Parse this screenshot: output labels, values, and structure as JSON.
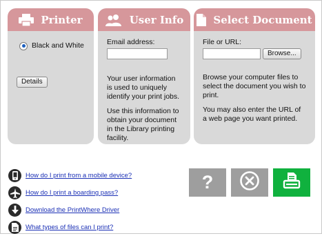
{
  "panels": {
    "printer": {
      "title": "Printer",
      "option_label": "Black and White",
      "details_label": "Details"
    },
    "user_info": {
      "title": "User Info",
      "email_label": "Email address:",
      "desc_1": "Your user information is used to uniquely identify your print jobs.",
      "desc_2": "Use this information to obtain your document in the Library printing facility."
    },
    "select_document": {
      "title": "Select Document",
      "file_label": "File or URL:",
      "browse_label": "Browse...",
      "desc_1": "Browse your computer files to select the document you wish to print.",
      "desc_2": "You may also enter the URL of a web page you want printed."
    }
  },
  "help_links": [
    {
      "icon": "mobile-phone-icon",
      "label": "How do I print from a mobile device?"
    },
    {
      "icon": "airplane-icon",
      "label": "How do I print a boarding pass?"
    },
    {
      "icon": "download-icon",
      "label": "Download the PrintWhere Driver"
    },
    {
      "icon": "document-icon",
      "label": "What types of files can I print?"
    }
  ],
  "actions": {
    "help_symbol": "?",
    "help_color": "#9e9e9e",
    "cancel_color": "#9e9e9e",
    "print_color": "#10b13e"
  },
  "colors": {
    "panel_header": "#d6979b",
    "panel_body": "#d9d9d9",
    "link": "#1a2fb5"
  }
}
